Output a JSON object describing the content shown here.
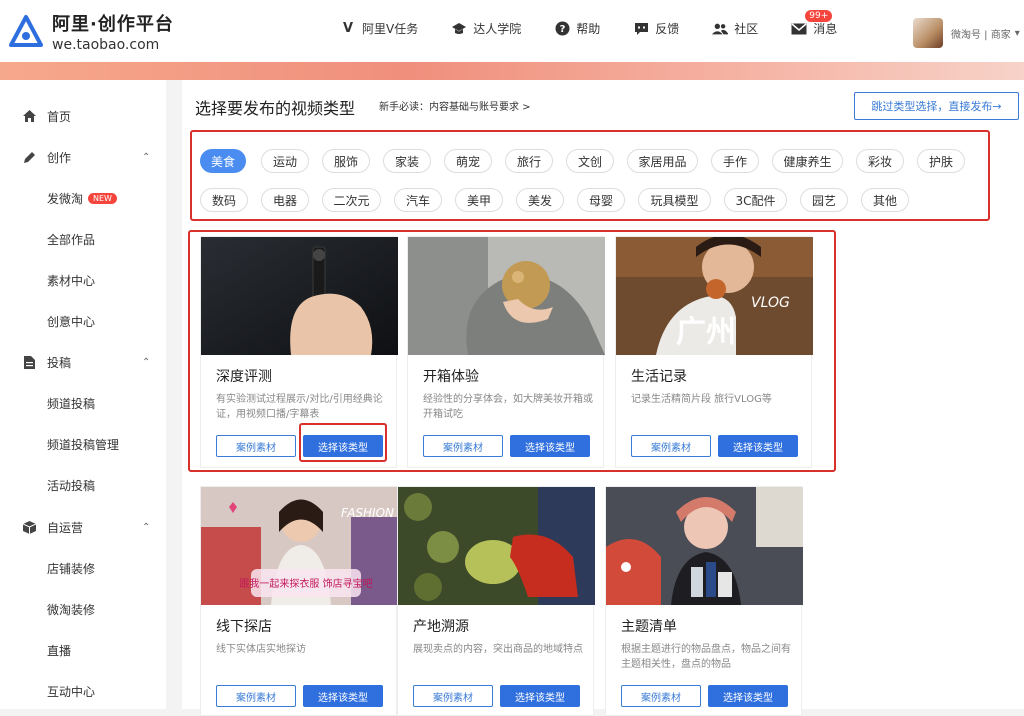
{
  "header": {
    "logo_title": "阿里·创作平台",
    "logo_sub": "we.taobao.com",
    "nav": [
      {
        "icon": "v-icon",
        "glyph": "V",
        "label": "阿里V任务"
      },
      {
        "icon": "graduation-cap-icon",
        "glyph": "🎓",
        "label": "达人学院"
      },
      {
        "icon": "help-icon",
        "glyph": "?",
        "label": "帮助"
      },
      {
        "icon": "feedback-icon",
        "glyph": "▤",
        "label": "反馈"
      },
      {
        "icon": "community-icon",
        "glyph": "👥",
        "label": "社区"
      },
      {
        "icon": "message-icon",
        "glyph": "✉",
        "label": "消息"
      }
    ],
    "message_badge": "99+",
    "user_label": "微淘号 | 商家"
  },
  "sidebar": {
    "items": [
      {
        "label": "首页",
        "icon": "home-icon",
        "glyph": "⌂",
        "group": true
      },
      {
        "label": "创作",
        "icon": "pen-icon",
        "glyph": "✎",
        "group": true,
        "expandable": true
      },
      {
        "label": "发微淘",
        "badge": "NEW"
      },
      {
        "label": "全部作品"
      },
      {
        "label": "素材中心"
      },
      {
        "label": "创意中心"
      },
      {
        "label": "投稿",
        "icon": "document-icon",
        "glyph": "▤",
        "group": true,
        "expandable": true
      },
      {
        "label": "频道投稿"
      },
      {
        "label": "频道投稿管理"
      },
      {
        "label": "活动投稿"
      },
      {
        "label": "自运营",
        "icon": "box-icon",
        "glyph": "▣",
        "group": true,
        "expandable": true
      },
      {
        "label": "店铺装修"
      },
      {
        "label": "微淘装修"
      },
      {
        "label": "直播"
      },
      {
        "label": "互动中心"
      }
    ]
  },
  "main": {
    "title": "选择要发布的视频类型",
    "hint": "新手必读：内容基础与账号要求 >",
    "skip_button": "跳过类型选择，直接发布→",
    "categories_row1": [
      "美食",
      "运动",
      "服饰",
      "家装",
      "萌宠",
      "旅行",
      "文创",
      "家居用品",
      "手作",
      "健康养生",
      "彩妆",
      "护肤"
    ],
    "categories_row2": [
      "数码",
      "电器",
      "二次元",
      "汽车",
      "美甲",
      "美发",
      "母婴",
      "玩具模型",
      "3C配件",
      "园艺",
      "其他"
    ],
    "active_category": "美食",
    "case_button": "案例素材",
    "pick_button": "选择该类型",
    "cards": [
      {
        "title": "深度评测",
        "desc": "有实验测试过程展示/对比/引用经典论证，用视频口播/字幕表"
      },
      {
        "title": "开箱体验",
        "desc": "经验性的分享体会，如大牌美妆开箱或开箱试吃"
      },
      {
        "title": "生活记录",
        "desc": "记录生活精简片段 旅行VLOG等"
      },
      {
        "title": "线下探店",
        "desc": "线下实体店实地探访"
      },
      {
        "title": "产地溯源",
        "desc": "展现卖点的内容，突出商品的地域特点"
      },
      {
        "title": "主题清单",
        "desc": "根据主题进行的物品盘点，物品之间有主题相关性，盘点的物品"
      }
    ],
    "thumb_texts": {
      "vlog": "VLOG",
      "guangzhou": "广州",
      "fashion": "FASHION",
      "shop_sign": "跟我一起来探衣服 饰店寻宝吧"
    }
  },
  "colors": {
    "accent": "#2f6fde",
    "highlight_red": "#d9302c",
    "badge_red": "#f5453d"
  }
}
